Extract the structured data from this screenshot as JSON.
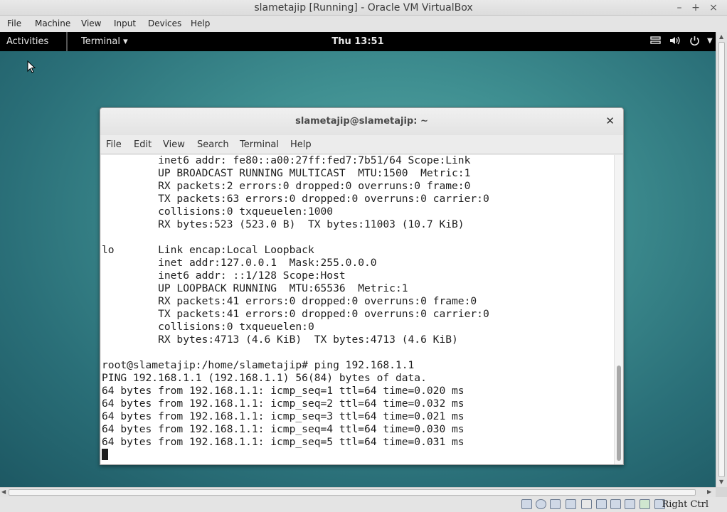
{
  "vbox": {
    "title": "slametajip [Running] - Oracle VM VirtualBox",
    "menu": [
      "File",
      "Machine",
      "View",
      "Input",
      "Devices",
      "Help"
    ],
    "host_key": "Right Ctrl"
  },
  "gnome": {
    "activities": "Activities",
    "app_menu": "Terminal ▾",
    "clock": "Thu 13:51"
  },
  "terminal": {
    "title": "slametajip@slametajip: ~",
    "menu": [
      "File",
      "Edit",
      "View",
      "Search",
      "Terminal",
      "Help"
    ],
    "lines": [
      "         inet6 addr: fe80::a00:27ff:fed7:7b51/64 Scope:Link",
      "         UP BROADCAST RUNNING MULTICAST  MTU:1500  Metric:1",
      "         RX packets:2 errors:0 dropped:0 overruns:0 frame:0",
      "         TX packets:63 errors:0 dropped:0 overruns:0 carrier:0",
      "         collisions:0 txqueuelen:1000",
      "         RX bytes:523 (523.0 B)  TX bytes:11003 (10.7 KiB)",
      "",
      "lo       Link encap:Local Loopback",
      "         inet addr:127.0.0.1  Mask:255.0.0.0",
      "         inet6 addr: ::1/128 Scope:Host",
      "         UP LOOPBACK RUNNING  MTU:65536  Metric:1",
      "         RX packets:41 errors:0 dropped:0 overruns:0 frame:0",
      "         TX packets:41 errors:0 dropped:0 overruns:0 carrier:0",
      "         collisions:0 txqueuelen:0",
      "         RX bytes:4713 (4.6 KiB)  TX bytes:4713 (4.6 KiB)",
      "",
      "root@slametajip:/home/slametajip# ping 192.168.1.1",
      "PING 192.168.1.1 (192.168.1.1) 56(84) bytes of data.",
      "64 bytes from 192.168.1.1: icmp_seq=1 ttl=64 time=0.020 ms",
      "64 bytes from 192.168.1.1: icmp_seq=2 ttl=64 time=0.032 ms",
      "64 bytes from 192.168.1.1: icmp_seq=3 ttl=64 time=0.021 ms",
      "64 bytes from 192.168.1.1: icmp_seq=4 ttl=64 time=0.030 ms",
      "64 bytes from 192.168.1.1: icmp_seq=5 ttl=64 time=0.031 ms"
    ]
  },
  "status_icons": [
    "hard-disk-icon",
    "optical-drive-icon",
    "usb-icon",
    "shared-folders-icon",
    "display-icon",
    "network-icon",
    "video-capture-icon",
    "cpu-icon",
    "audio-icon",
    "mouse-integration-icon",
    "host-key-arrow-icon"
  ],
  "colors": {
    "desktop_teal": "#3f8f91",
    "topbar": "#000000",
    "terminal_bg": "#ffffff"
  }
}
